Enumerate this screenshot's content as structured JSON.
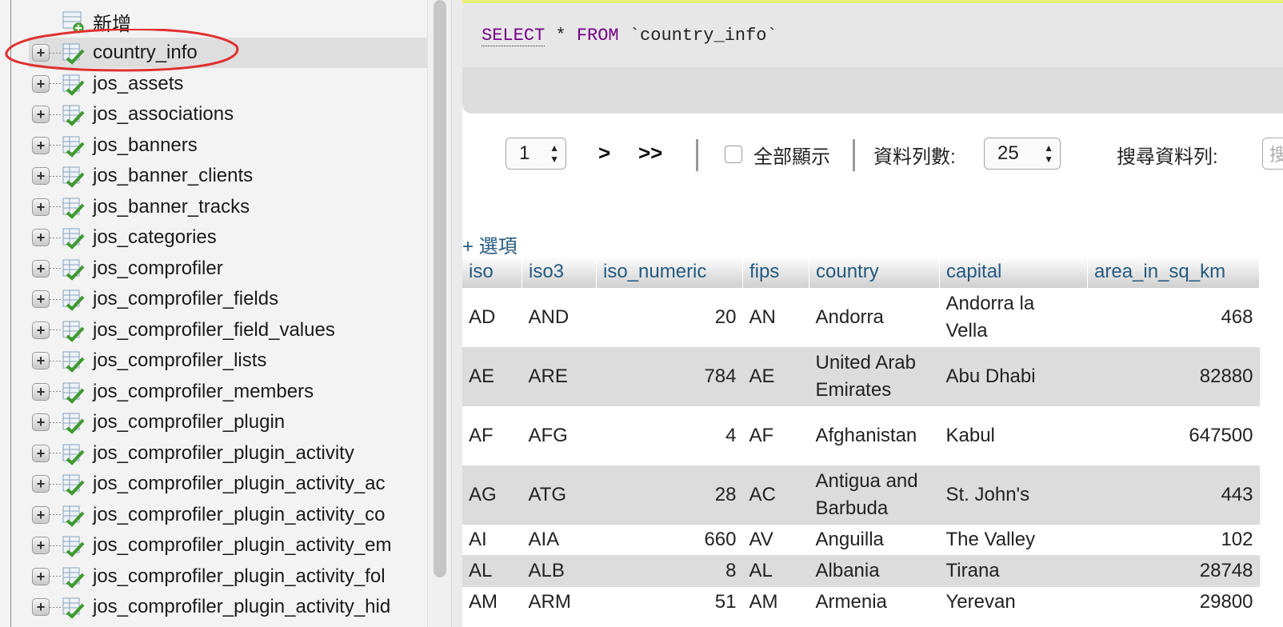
{
  "nav": {
    "new_label": "新增",
    "tables": [
      "country_info",
      "jos_assets",
      "jos_associations",
      "jos_banners",
      "jos_banner_clients",
      "jos_banner_tracks",
      "jos_categories",
      "jos_comprofiler",
      "jos_comprofiler_fields",
      "jos_comprofiler_field_values",
      "jos_comprofiler_lists",
      "jos_comprofiler_members",
      "jos_comprofiler_plugin",
      "jos_comprofiler_plugin_activity",
      "jos_comprofiler_plugin_activity_ac",
      "jos_comprofiler_plugin_activity_co",
      "jos_comprofiler_plugin_activity_em",
      "jos_comprofiler_plugin_activity_fol",
      "jos_comprofiler_plugin_activity_hid"
    ],
    "selected_table": "country_info",
    "annotation_color": "#e03030"
  },
  "sql": {
    "kw_select": "SELECT",
    "star": "*",
    "kw_from": "FROM",
    "table": "`country_info`"
  },
  "pager": {
    "page_value": "1",
    "next_label": ">",
    "last_label": ">>",
    "show_all_label": "全部顯示",
    "rows_label": "資料列數:",
    "rows_value": "25",
    "search_label": "搜尋資料列:",
    "search_placeholder": "搜"
  },
  "options_label": "+ 選項",
  "table": {
    "columns": [
      "iso",
      "iso3",
      "iso_numeric",
      "fips",
      "country",
      "capital",
      "area_in_sq_km"
    ],
    "rows": [
      [
        "AD",
        "AND",
        "20",
        "AN",
        "Andorra",
        "Andorra la Vella",
        "468"
      ],
      [
        "AE",
        "ARE",
        "784",
        "AE",
        "United Arab Emirates",
        "Abu Dhabi",
        "82880"
      ],
      [
        "AF",
        "AFG",
        "4",
        "AF",
        "Afghanistan",
        "Kabul",
        "647500"
      ],
      [
        "AG",
        "ATG",
        "28",
        "AC",
        "Antigua and Barbuda",
        "St. John's",
        "443"
      ],
      [
        "AI",
        "AIA",
        "660",
        "AV",
        "Anguilla",
        "The Valley",
        "102"
      ],
      [
        "AL",
        "ALB",
        "8",
        "AL",
        "Albania",
        "Tirana",
        "28748"
      ],
      [
        "AM",
        "ARM",
        "51",
        "AM",
        "Armenia",
        "Yerevan",
        "29800"
      ]
    ]
  },
  "colors": {
    "link": "#235a81",
    "keyword": "#770088",
    "row_alt": "#dcdcdc"
  }
}
